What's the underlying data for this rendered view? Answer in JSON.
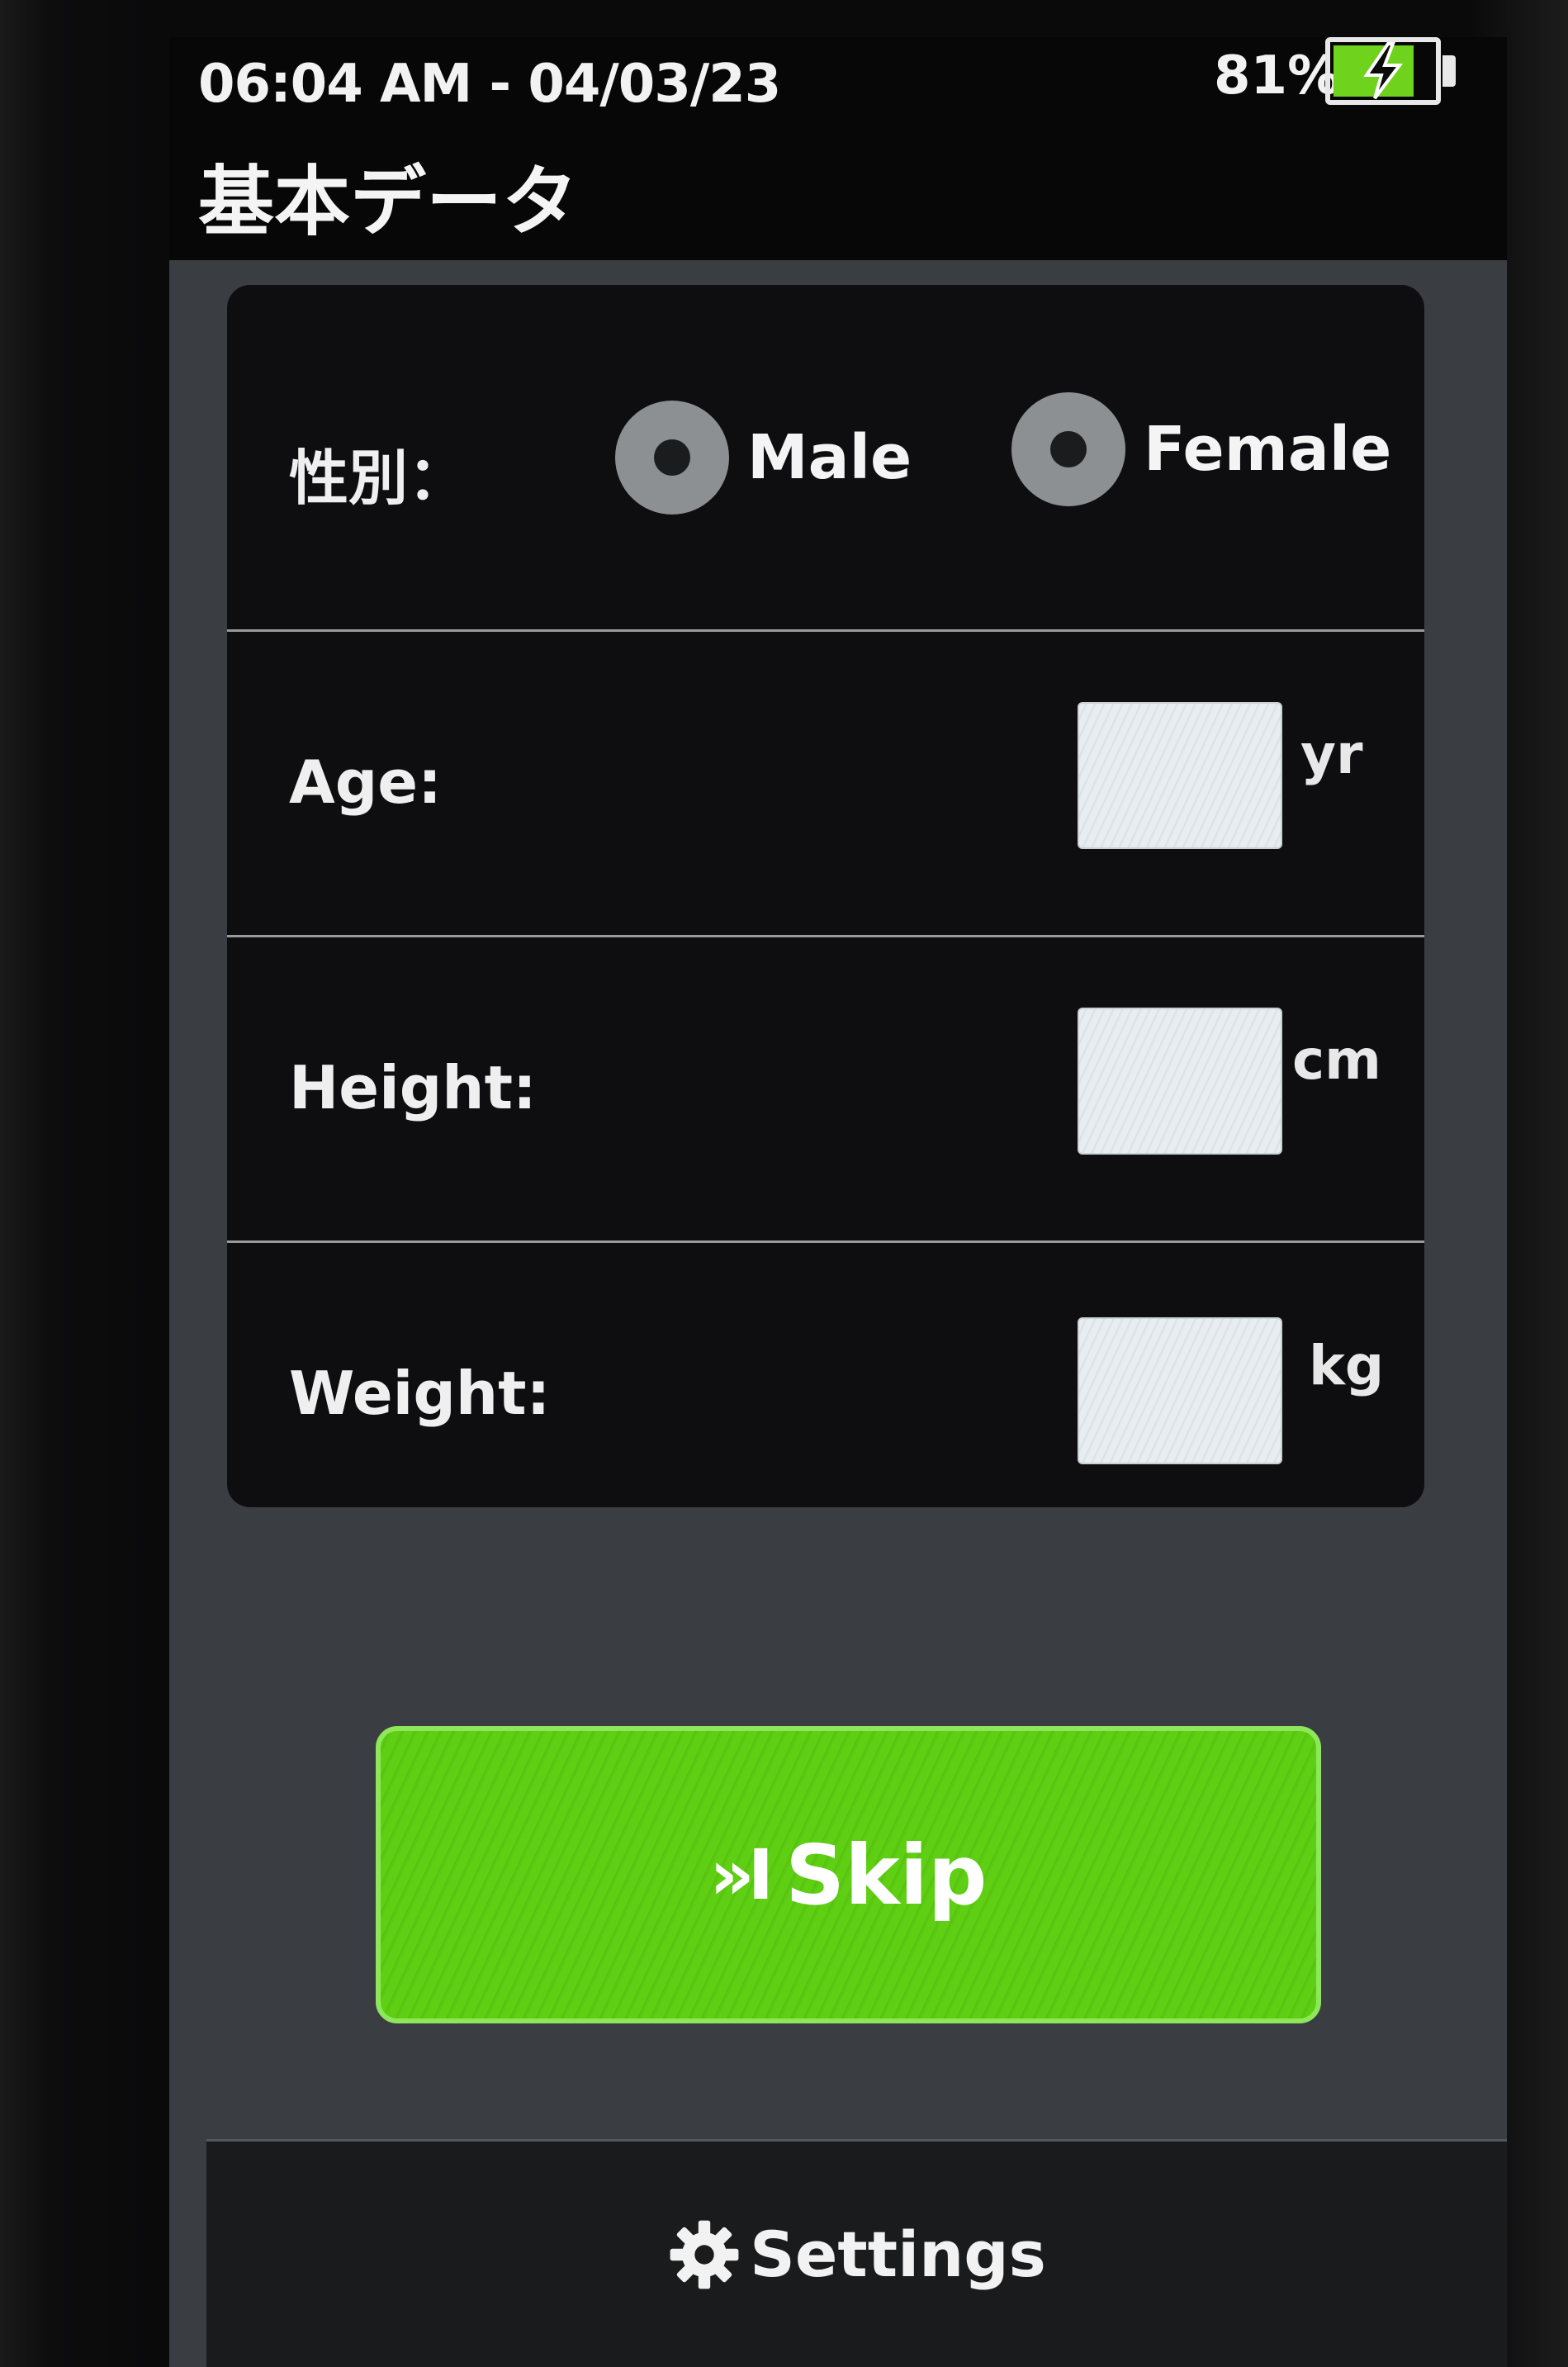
{
  "status_bar": {
    "datetime": "06:04 AM - 04/03/23",
    "battery_percent": "81%",
    "battery_level": 0.81,
    "battery_icon": "battery-charging-icon"
  },
  "header": {
    "title": "基本データ"
  },
  "form": {
    "gender": {
      "label": "性別：",
      "options": [
        {
          "label": "Male",
          "icon": "radio-button-icon"
        },
        {
          "label": "Female",
          "icon": "radio-button-icon"
        }
      ]
    },
    "age": {
      "label": "Age:",
      "value": "",
      "unit": "yr"
    },
    "height": {
      "label": "Height:",
      "value": "",
      "unit": "cm"
    },
    "weight": {
      "label": "Weight:",
      "value": "",
      "unit": "kg"
    }
  },
  "actions": {
    "skip_icon": "skip-forward-icon",
    "skip_icon_glyph": "»I",
    "skip_label": "Skip",
    "settings_icon": "gear-icon",
    "settings_label": "Settings"
  },
  "colors": {
    "accent_green": "#5fcf14",
    "background": "#3a3d41",
    "card": "#0e0e10"
  }
}
